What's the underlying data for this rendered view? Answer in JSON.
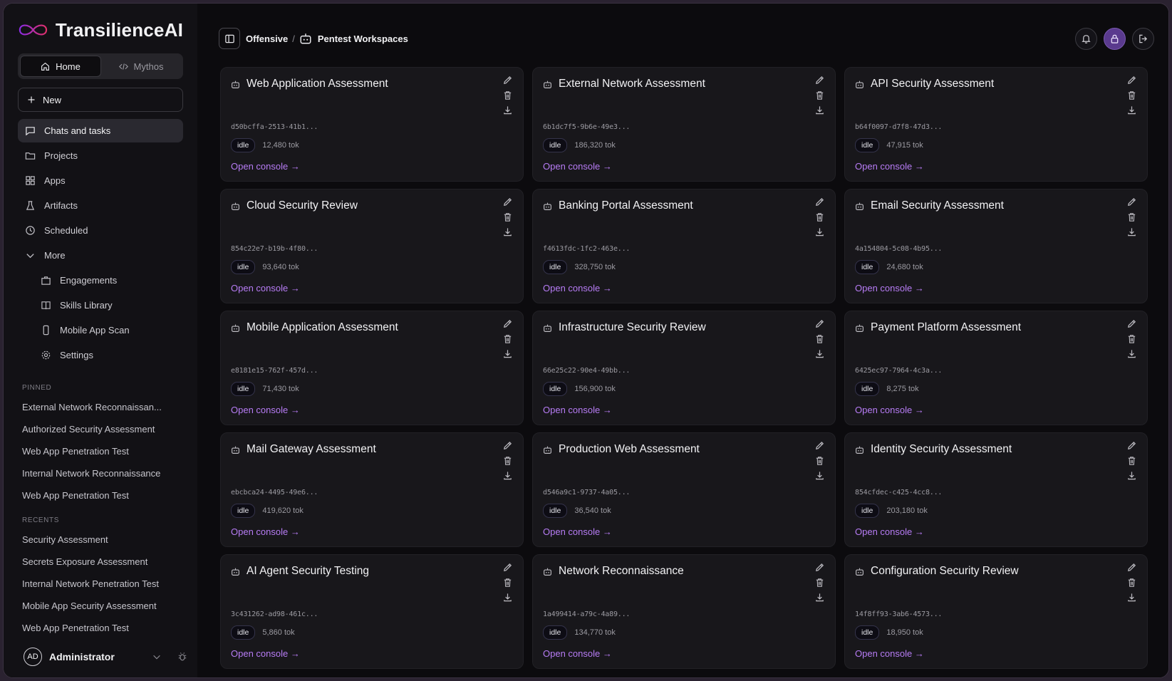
{
  "brand": {
    "name": "TransilienceAI"
  },
  "modes": [
    {
      "label": "Home",
      "icon": "home-icon",
      "active": true
    },
    {
      "label": "Mythos",
      "icon": "code-icon",
      "active": false
    }
  ],
  "new_button": {
    "label": "New"
  },
  "nav": [
    {
      "label": "Chats and tasks",
      "icon": "chat-icon",
      "active": true
    },
    {
      "label": "Projects",
      "icon": "folder-icon"
    },
    {
      "label": "Apps",
      "icon": "grid-icon"
    },
    {
      "label": "Artifacts",
      "icon": "flask-icon"
    },
    {
      "label": "Scheduled",
      "icon": "clock-icon"
    },
    {
      "label": "More",
      "icon": "chevron-down-icon"
    }
  ],
  "more_items": [
    {
      "label": "Engagements",
      "icon": "briefcase-icon"
    },
    {
      "label": "Skills Library",
      "icon": "book-icon"
    },
    {
      "label": "Mobile App Scan",
      "icon": "phone-icon"
    },
    {
      "label": "Settings",
      "icon": "gear-icon"
    }
  ],
  "pinned": {
    "label": "PINNED",
    "items": [
      "External Network Reconnaissan...",
      "Authorized Security Assessment",
      "Web App Penetration Test",
      "Internal Network Reconnaissance",
      "Web App Penetration Test"
    ]
  },
  "recents": {
    "label": "RECENTS",
    "items": [
      "Security Assessment",
      "Secrets Exposure Assessment",
      "Internal Network Penetration Test",
      "Mobile App Security Assessment",
      "Web App Penetration Test"
    ]
  },
  "user": {
    "initials": "AD",
    "name": "Administrator"
  },
  "breadcrumb": {
    "parent": "Offensive",
    "separator": "/",
    "current": "Pentest Workspaces"
  },
  "console_link": "Open console →",
  "workspaces": [
    {
      "title": "Web Application Assessment",
      "id": "d50bcffa-2513-41b1...",
      "status": "idle",
      "tokens": "12,480 tok"
    },
    {
      "title": "External Network Assessment",
      "id": "6b1dc7f5-9b6e-49e3...",
      "status": "idle",
      "tokens": "186,320 tok"
    },
    {
      "title": "API Security Assessment",
      "id": "b64f0097-d7f8-47d3...",
      "status": "idle",
      "tokens": "47,915 tok"
    },
    {
      "title": "Cloud Security Review",
      "id": "854c22e7-b19b-4f80...",
      "status": "idle",
      "tokens": "93,640 tok"
    },
    {
      "title": "Banking Portal Assessment",
      "id": "f4613fdc-1fc2-463e...",
      "status": "idle",
      "tokens": "328,750 tok"
    },
    {
      "title": "Email Security Assessment",
      "id": "4a154804-5c08-4b95...",
      "status": "idle",
      "tokens": "24,680 tok"
    },
    {
      "title": "Mobile Application Assessment",
      "id": "e8181e15-762f-457d...",
      "status": "idle",
      "tokens": "71,430 tok"
    },
    {
      "title": "Infrastructure Security Review",
      "id": "66e25c22-90e4-49bb...",
      "status": "idle",
      "tokens": "156,900 tok"
    },
    {
      "title": "Payment Platform Assessment",
      "id": "6425ec97-7964-4c3a...",
      "status": "idle",
      "tokens": "8,275 tok"
    },
    {
      "title": "Mail Gateway Assessment",
      "id": "ebcbca24-4495-49e6...",
      "status": "idle",
      "tokens": "419,620 tok"
    },
    {
      "title": "Production Web Assessment",
      "id": "d546a9c1-9737-4a05...",
      "status": "idle",
      "tokens": "36,540 tok"
    },
    {
      "title": "Identity Security Assessment",
      "id": "854cfdec-c425-4cc8...",
      "status": "idle",
      "tokens": "203,180 tok"
    },
    {
      "title": "AI Agent Security Testing",
      "id": "3c431262-ad98-461c...",
      "status": "idle",
      "tokens": "5,860 tok"
    },
    {
      "title": "Network Reconnaissance",
      "id": "1a499414-a79c-4a89...",
      "status": "idle",
      "tokens": "134,770 tok"
    },
    {
      "title": "Configuration Security Review",
      "id": "14f8ff93-3ab6-4573...",
      "status": "idle",
      "tokens": "18,950 tok"
    }
  ],
  "colors": {
    "accent": "#b77cf5",
    "avatar_button": "#5a3a8e",
    "background": "#0c0b0e",
    "card": "#18171b"
  }
}
